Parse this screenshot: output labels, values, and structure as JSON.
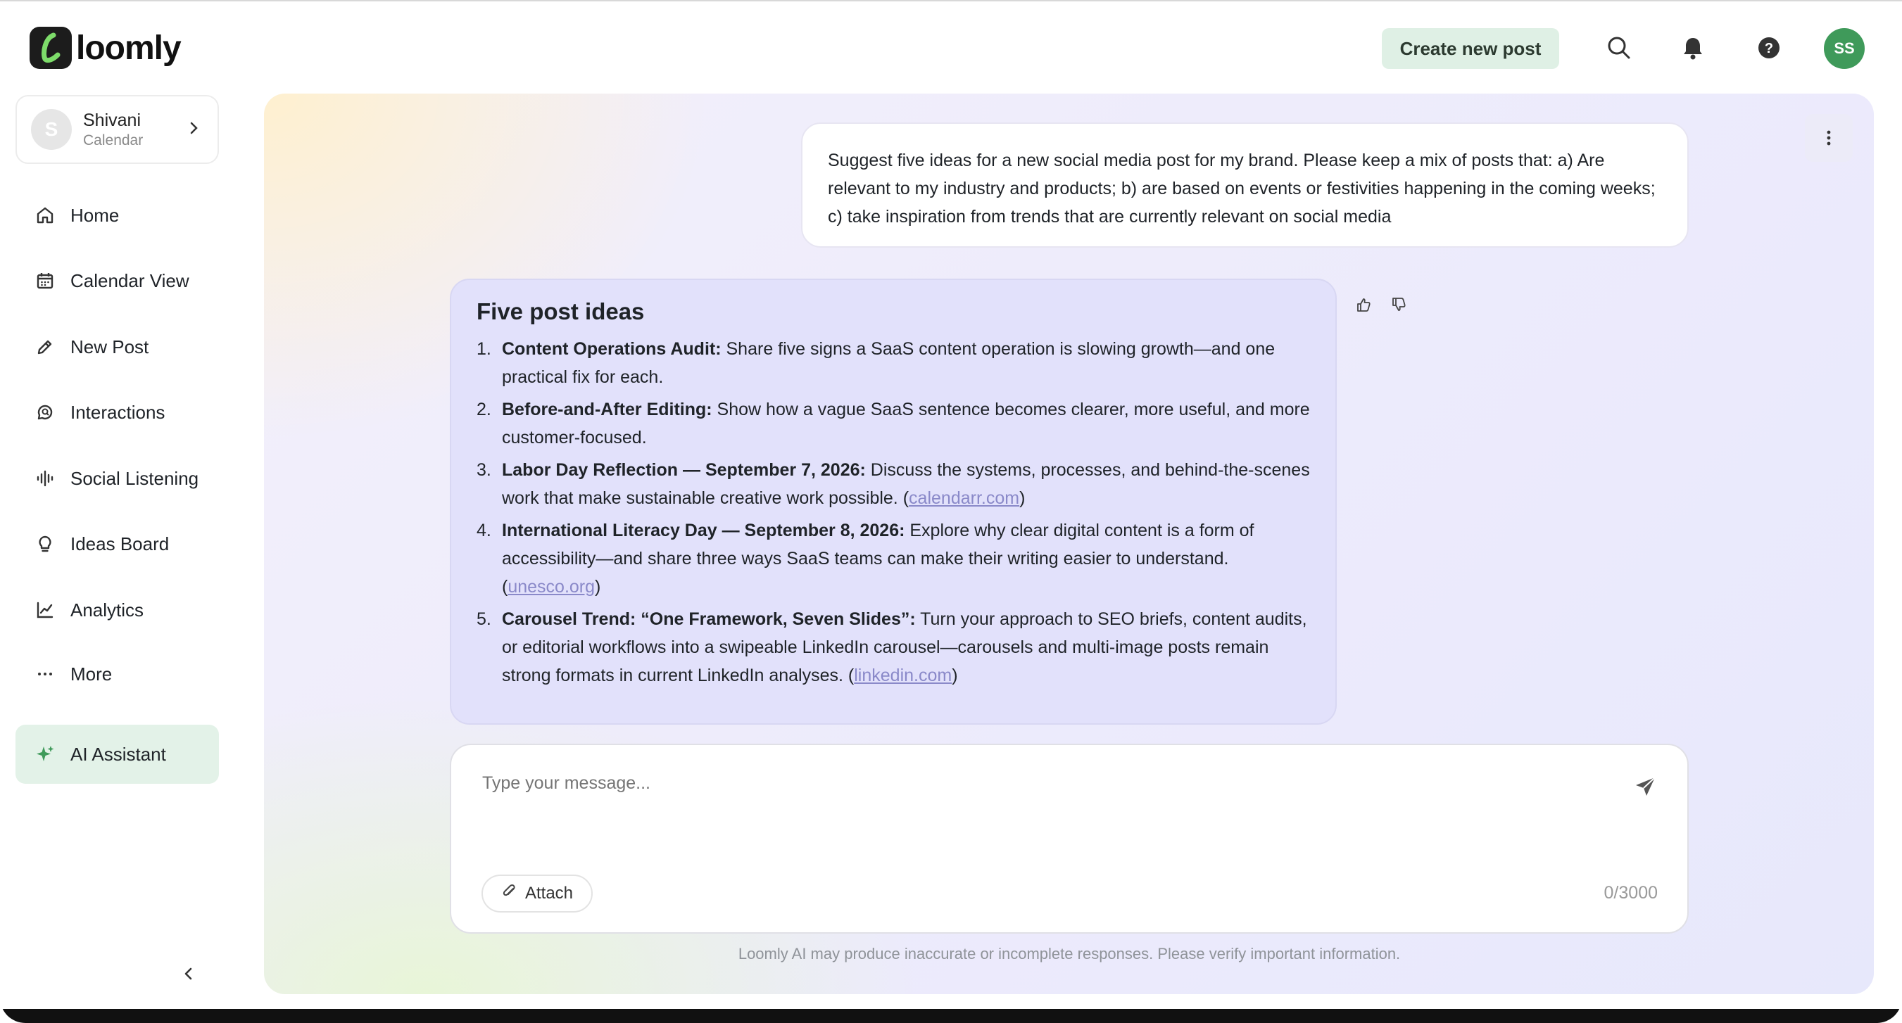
{
  "brand": {
    "name": "loomly",
    "accent": "#3f9a5a"
  },
  "header": {
    "create_label": "Create new post",
    "avatar_initials": "SS",
    "icons": [
      "search-icon",
      "bell-icon",
      "help-icon"
    ]
  },
  "workspace": {
    "initial": "S",
    "name": "Shivani",
    "sub": "Calendar"
  },
  "sidebar": {
    "items": [
      {
        "label": "Home",
        "icon": "home-icon"
      },
      {
        "label": "Calendar View",
        "icon": "calendar-icon"
      },
      {
        "label": "New Post",
        "icon": "pencil-icon"
      },
      {
        "label": "Interactions",
        "icon": "chat-search-icon"
      },
      {
        "label": "Social Listening",
        "icon": "soundwave-icon"
      },
      {
        "label": "Ideas Board",
        "icon": "lightbulb-icon"
      },
      {
        "label": "Analytics",
        "icon": "chart-icon"
      },
      {
        "label": "More",
        "icon": "ellipsis-icon"
      },
      {
        "label": "AI Assistant",
        "icon": "sparkle-icon",
        "active": true
      }
    ]
  },
  "chat": {
    "user_message": "Suggest five ideas for a new social media post for my brand. Please keep a mix of posts that: a) Are relevant to my industry and products; b) are based on events or festivities happening in the coming weeks; c) take inspiration from trends that are currently relevant on social media",
    "ai_title": "Five post ideas",
    "ideas": [
      {
        "num": "1.",
        "bold": "Content Operations Audit:",
        "text": " Share five signs a SaaS content operation is slowing growth—and one practical fix for each.",
        "pre": "",
        "link": "",
        "post": ""
      },
      {
        "num": "2.",
        "bold": "Before-and-After Editing:",
        "text": " Show how a vague SaaS sentence becomes clearer, more useful, and more customer-focused.",
        "pre": "",
        "link": "",
        "post": ""
      },
      {
        "num": "3.",
        "bold": "Labor Day Reflection — September 7, 2026:",
        "text": " Discuss the systems, processes, and behind-the-scenes work that make sustainable creative work possible.",
        "pre": " (",
        "link": "calendarr.com",
        "post": ")"
      },
      {
        "num": "4.",
        "bold": "International Literacy Day — September 8, 2026:",
        "text": " Explore why clear digital content is a form of accessibility—and share three ways SaaS teams can make their writing easier to understand.",
        "pre": " (",
        "link": "unesco.org",
        "post": ")"
      },
      {
        "num": "5.",
        "bold": "Carousel Trend: “One Framework, Seven Slides”:",
        "text": " Turn your approach to SEO briefs, content audits, or editorial workflows into a swipeable LinkedIn carousel—carousels and multi-image posts remain strong formats in current LinkedIn analyses.",
        "pre": " (",
        "link": "linkedin.com",
        "post": ")"
      }
    ]
  },
  "composer": {
    "placeholder": "Type your message...",
    "attach_label": "Attach",
    "counter": "0/3000"
  },
  "disclaimer": "Loomly AI may produce inaccurate or incomplete responses. Please verify important information."
}
